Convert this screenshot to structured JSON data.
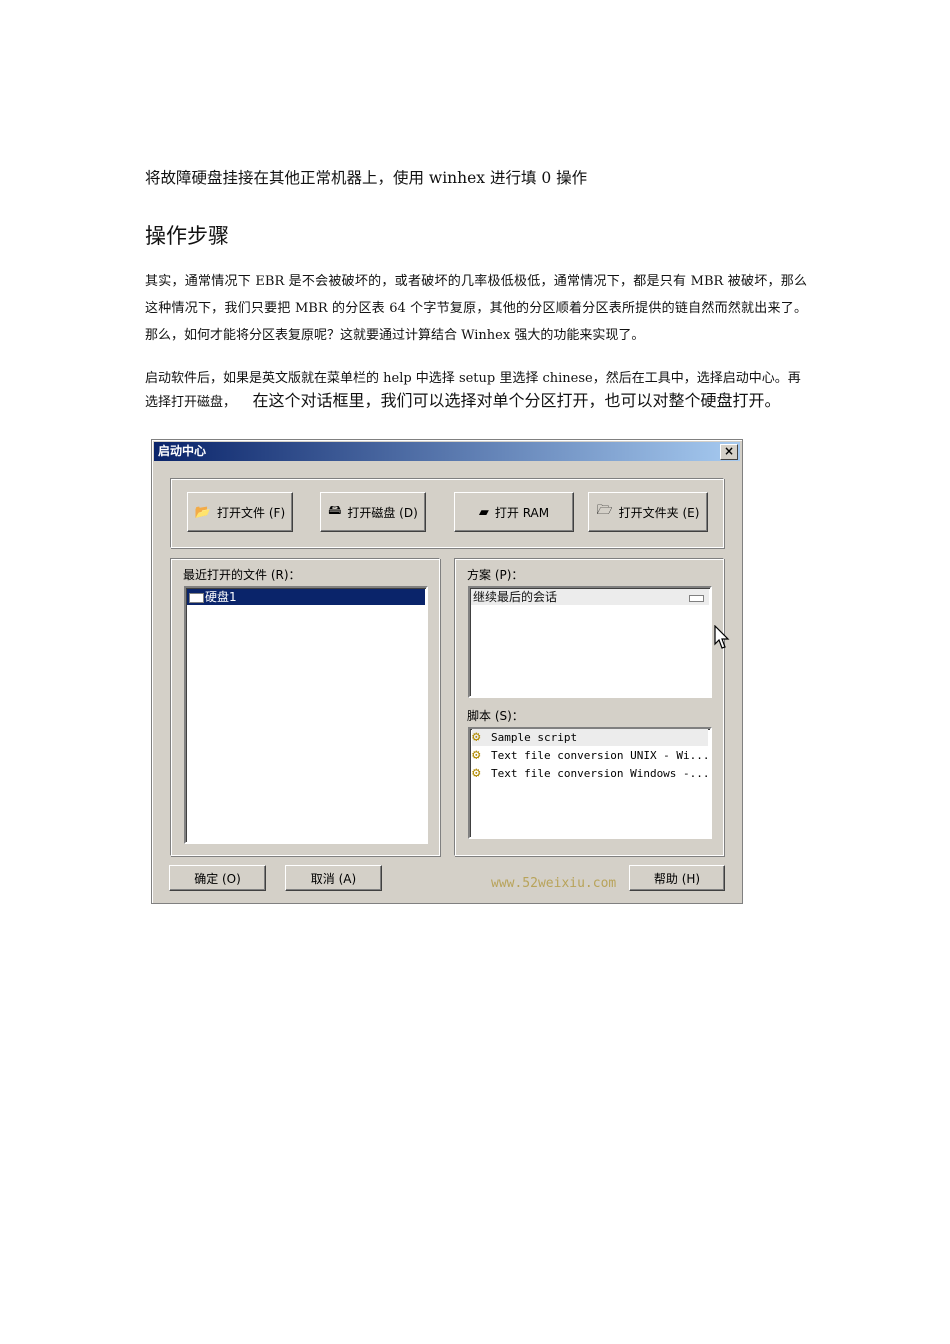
{
  "doc": {
    "intro": "将故障硬盘挂接在其他正常机器上，使用 winhex 进行填 0 操作",
    "heading": "操作步骤",
    "para1": "其实，通常情况下 EBR 是不会被破坏的，或者破坏的几率极低极低，通常情况下，都是只有 MBR 被破坏，那么这种情况下，我们只要把 MBR 的分区表 64 个字节复原，其他的分区顺着分区表所提供的链自然而然就出来了。那么，如何才能将分区表复原呢？这就要通过计算结合 Winhex 强大的功能来实现了。",
    "para2_small": "启动软件后，如果是英文版就在菜单栏的 help 中选择 setup 里选择 chinese，然后在工具中，选择启动中心。再选择打开磁盘，",
    "para2_big": "在这个对话框里，我们可以选择对单个分区打开，也可以对整个硬盘打开。"
  },
  "dialog": {
    "title": "启动中心",
    "close": "×",
    "toolbar": {
      "open_file": "打开文件 (F)",
      "open_disk": "打开磁盘 (D)",
      "open_ram": "打开 RAM",
      "open_folder": "打开文件夹 (E)"
    },
    "recent_label": "最近打开的文件 (R)：",
    "recent_items": [
      "硬盘1"
    ],
    "scheme_label": "方案 (P)：",
    "scheme_item": "继续最后的会话",
    "script_label": "脚本 (S)：",
    "scripts": [
      "Sample script",
      "Text file conversion UNIX - Wi...",
      "Text file conversion Windows -..."
    ],
    "ok": "确定 (O)",
    "cancel": "取消 (A)",
    "help": "帮助 (H)"
  },
  "watermark": "www.52weixiu.com"
}
